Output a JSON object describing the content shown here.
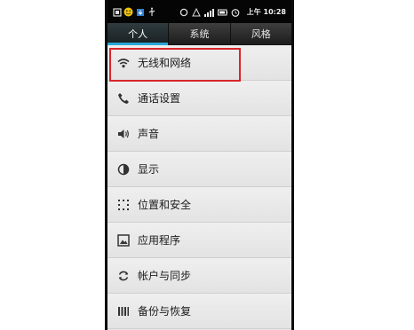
{
  "status_bar": {
    "time": "上午 10:28",
    "icons": [
      "notification-icon",
      "emoji-icon",
      "download-icon",
      "usb-icon",
      "sync-icon",
      "alert-icon",
      "signal-icon",
      "battery-icon",
      "alarm-icon"
    ]
  },
  "tabs": [
    {
      "label": "个人",
      "active": true
    },
    {
      "label": "系统",
      "active": false
    },
    {
      "label": "风格",
      "active": false
    }
  ],
  "menu": [
    {
      "label": "无线和网络",
      "icon": "wifi-icon",
      "highlighted": true
    },
    {
      "label": "通话设置",
      "icon": "phone-icon",
      "highlighted": false
    },
    {
      "label": "声音",
      "icon": "speaker-icon",
      "highlighted": false
    },
    {
      "label": "显示",
      "icon": "brightness-icon",
      "highlighted": false
    },
    {
      "label": "位置和安全",
      "icon": "location-grid-icon",
      "highlighted": false
    },
    {
      "label": "应用程序",
      "icon": "apps-icon",
      "highlighted": false
    },
    {
      "label": "帐户与同步",
      "icon": "sync-icon",
      "highlighted": false
    },
    {
      "label": "备份与恢复",
      "icon": "backup-icon",
      "highlighted": false
    }
  ],
  "colors": {
    "accent": "#2aa7d8",
    "highlight": "#d9262c",
    "menu_bg": "#e9e9e9"
  }
}
